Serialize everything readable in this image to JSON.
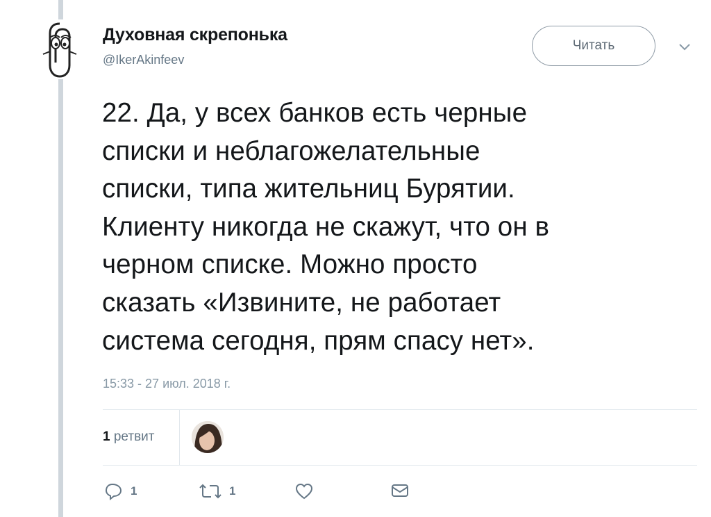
{
  "author": {
    "name": "Духовная скрепонька",
    "handle": "@IkerAkinfeev"
  },
  "follow_button": {
    "label": "Читать"
  },
  "tweet": {
    "text": "22. Да, у всех банков есть черные\nсписки и неблагожелательные\nсписки, типа жительниц Бурятии.\nКлиенту никогда не скажут, что он в\nчерном списке. Можно просто\nсказать «Извините, не работает\nсистема сегодня, прям спасу нет».",
    "timestamp": "15:33 - 27 июл. 2018 г."
  },
  "stats": {
    "retweets_count": "1",
    "retweets_label": "ретвит"
  },
  "actions": {
    "reply_count": "1",
    "retweet_count": "1"
  },
  "icons": {
    "reply": "reply-icon",
    "retweet": "retweet-icon",
    "like": "heart-icon",
    "dm": "envelope-icon",
    "more": "chevron-down-icon"
  },
  "colors": {
    "text": "#14171a",
    "secondary": "#657786",
    "thread_line": "#cfd6dc"
  }
}
